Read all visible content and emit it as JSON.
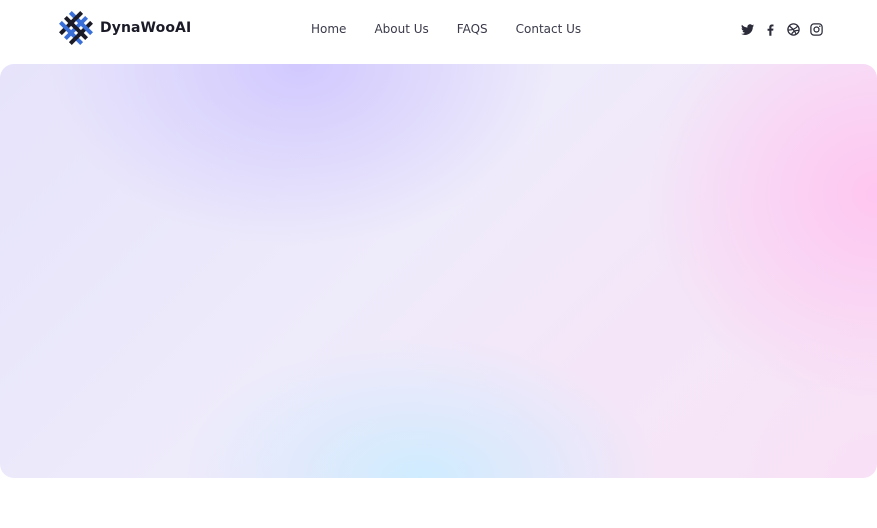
{
  "brand": {
    "name": "DynaWooAI",
    "logo_icon": "woven-cross-logo-icon"
  },
  "nav": {
    "items": [
      {
        "label": "Home"
      },
      {
        "label": "About Us"
      },
      {
        "label": "FAQS"
      },
      {
        "label": "Contact Us"
      }
    ]
  },
  "social": {
    "icons": [
      "twitter-icon",
      "facebook-icon",
      "dribbble-icon",
      "instagram-icon"
    ]
  },
  "colors": {
    "logo_dark": "#1b1b28",
    "logo_accent": "#3a6fd8",
    "hero_violet": "#cdc4ff",
    "hero_pink": "#ffc4f0",
    "hero_sky": "#cdecff"
  }
}
